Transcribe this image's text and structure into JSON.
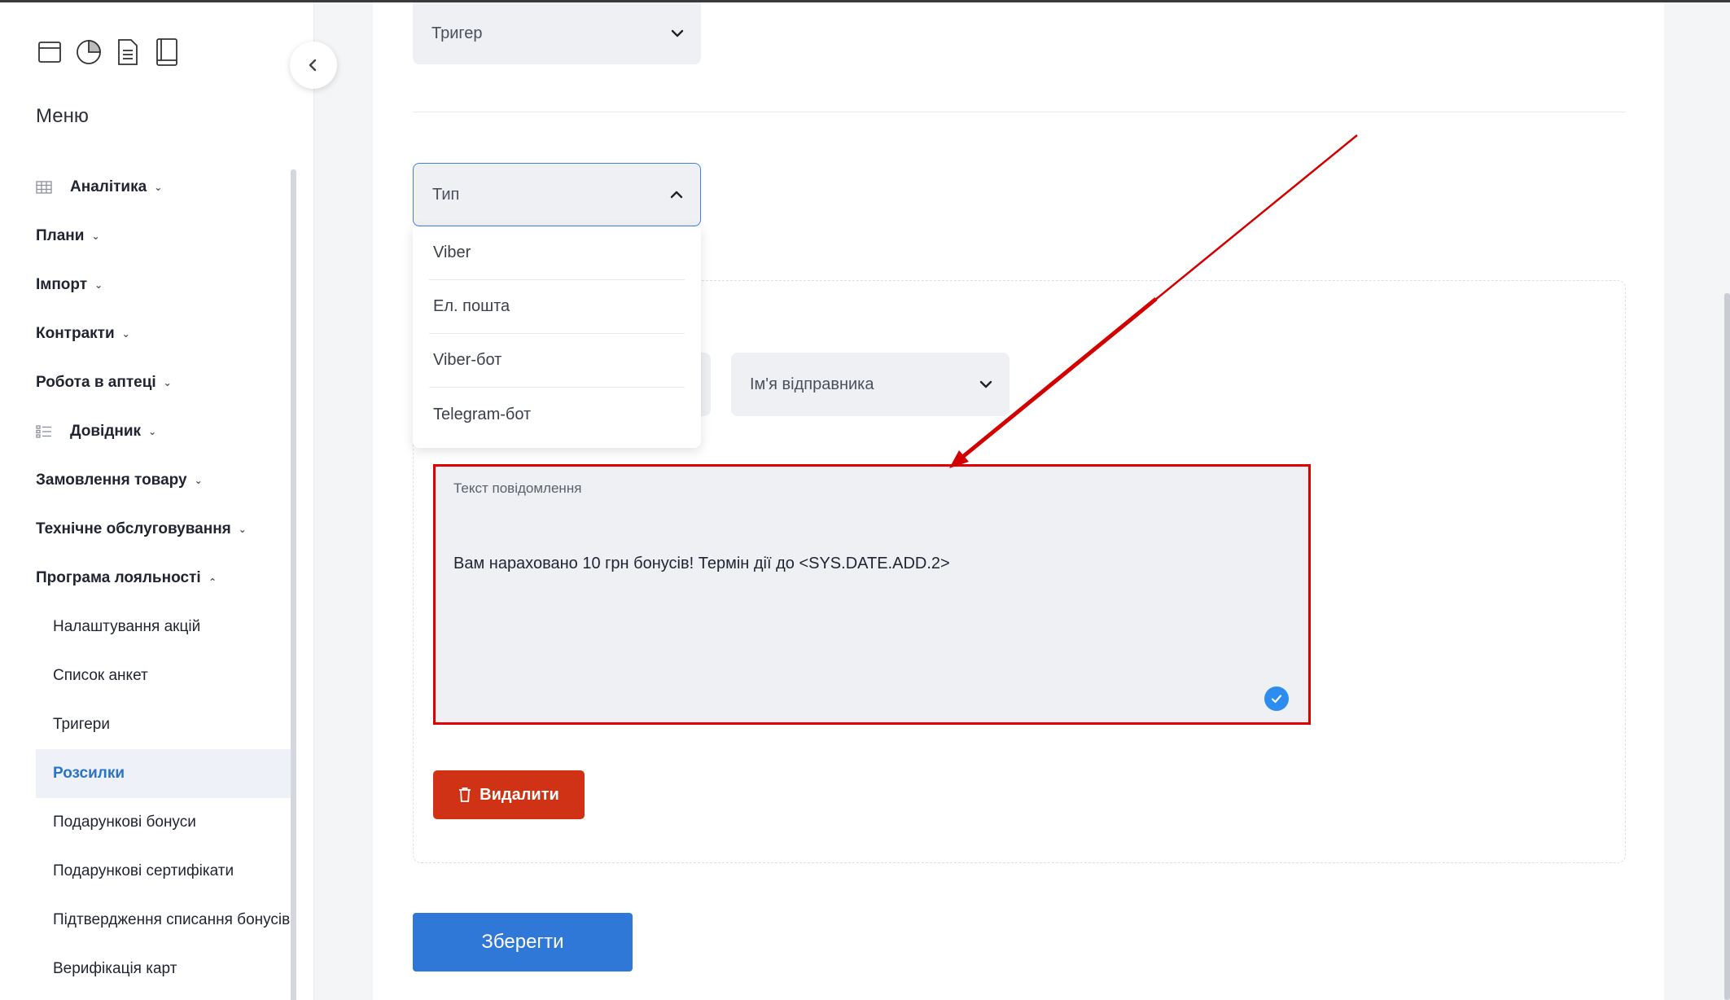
{
  "sidebar": {
    "title": "Меню",
    "top_icons": [
      "archive-icon",
      "pie-chart-icon",
      "document-icon",
      "book-icon"
    ],
    "menu": [
      {
        "label": "Аналітика",
        "icon": "table-icon",
        "expanded": false
      },
      {
        "label": "Плани",
        "expanded": false
      },
      {
        "label": "Імпорт",
        "expanded": false
      },
      {
        "label": "Контракти",
        "expanded": false
      },
      {
        "label": "Робота в аптеці",
        "expanded": false
      },
      {
        "label": "Довідник",
        "icon": "list-icon",
        "expanded": false
      },
      {
        "label": "Замовлення товару",
        "expanded": false
      },
      {
        "label": "Технічне обслуговування",
        "expanded": false
      },
      {
        "label": "Програма лояльності",
        "expanded": true
      }
    ],
    "submenu": [
      {
        "label": "Налаштування акцій"
      },
      {
        "label": "Список анкет"
      },
      {
        "label": "Тригери"
      },
      {
        "label": "Розсилки",
        "active": true
      },
      {
        "label": "Подарункові бонуси"
      },
      {
        "label": "Подарункові сертифікати"
      },
      {
        "label": "Підтвердження списання бонусів"
      },
      {
        "label": "Верифікація карт"
      }
    ]
  },
  "form": {
    "trigger_select": "Тригер",
    "type_select": "Тип",
    "type_options": [
      "Viber",
      "Ел. пошта",
      "Viber-бот",
      "Telegram-бот"
    ],
    "sender_select": "Ім'я відправника",
    "message_label": "Текст повідомлення",
    "message_text": "Вам нараховано 10 грн бонусів! Термін дії до <SYS.DATE.ADD.2>",
    "delete_label": "Видалити",
    "save_label": "Зберегти"
  },
  "colors": {
    "accent": "#2f78d8",
    "danger": "#cf3214",
    "highlight": "#e00000"
  }
}
